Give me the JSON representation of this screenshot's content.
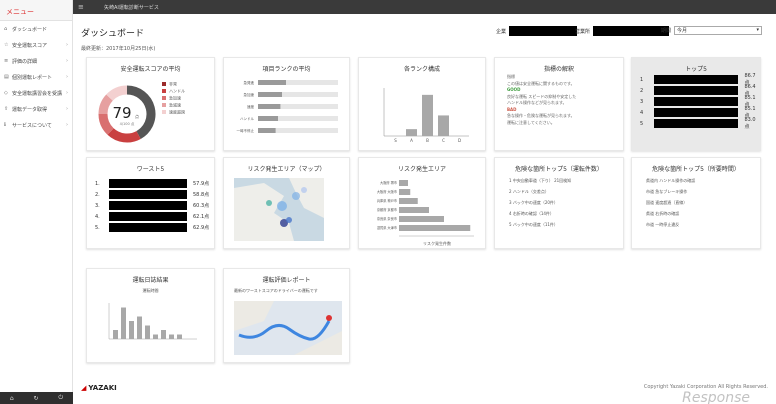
{
  "sidebar": {
    "menu_label": "メニュー",
    "items": [
      {
        "icon": "home-icon",
        "label": "ダッシュボード"
      },
      {
        "icon": "star-icon",
        "label": "安全運転スコア"
      },
      {
        "icon": "list-icon",
        "label": "評価の詳細"
      },
      {
        "icon": "document-icon",
        "label": "個別運転レポート"
      },
      {
        "icon": "shield-icon",
        "label": "安全運転講習会を受講"
      },
      {
        "icon": "upload-icon",
        "label": "運転データ取得"
      },
      {
        "icon": "info-icon",
        "label": "サービスについて"
      }
    ],
    "bottom_icons": [
      "home-icon",
      "refresh-icon",
      "power-icon"
    ]
  },
  "topbar": {
    "title": "矢崎AI運転診断サービス"
  },
  "header": {
    "title": "ダッシュボード",
    "updated": "最終更新：2017年10月25日(水)",
    "filter_company_label": "企業",
    "filter_office_label": "営業所",
    "filter_period_label": "期間",
    "filter_period_value": "今月"
  },
  "cards": {
    "score_avg": {
      "title": "安全運転スコアの平均",
      "score": "79",
      "sub": "4/100 点",
      "legend": [
        "非常",
        "ハンドル",
        "急加速",
        "急減速",
        "速度超過"
      ],
      "legend_colors": [
        "#9b2b2b",
        "#c94040",
        "#d97070",
        "#e6a0a0",
        "#f3d0d0"
      ],
      "segments": [
        0.42,
        0.2,
        0.13,
        0.12,
        0.13
      ]
    },
    "rank_avg": {
      "title": "項目ランクの平均",
      "rows": [
        "急発進",
        "急加速",
        "速度",
        "ハンドル",
        "一時不停止"
      ],
      "values": [
        0.35,
        0.3,
        0.28,
        0.25,
        0.22
      ]
    },
    "rank_dist": {
      "title": "各ランク構成",
      "categories": [
        "S",
        "A",
        "B",
        "C",
        "D"
      ],
      "values": [
        0,
        1,
        6,
        3,
        0
      ]
    },
    "how_to_read": {
      "title": "指標の解釈",
      "lines": [
        "指標",
        "この値は安全運転に関するものです。",
        "GOOD",
        "良好な運転 スピードの抑制や安定した",
        "ハンドル操作などが見られます。",
        "BAD",
        "急な操作・危険な運転が見られます。",
        "運転に注意してください。"
      ]
    },
    "top5": {
      "title": "トップ5",
      "rows": [
        {
          "n": "1",
          "v": "86.7点"
        },
        {
          "n": "2",
          "v": "86.4点"
        },
        {
          "n": "3",
          "v": "85.1点"
        },
        {
          "n": "4",
          "v": "85.1点"
        },
        {
          "n": "5",
          "v": "83.0点"
        }
      ]
    },
    "worst5": {
      "title": "ワースト5",
      "rows": [
        {
          "n": "1.",
          "v": "57.9点"
        },
        {
          "n": "2.",
          "v": "58.8点"
        },
        {
          "n": "3.",
          "v": "60.3点"
        },
        {
          "n": "4.",
          "v": "62.1点"
        },
        {
          "n": "5.",
          "v": "62.9点"
        }
      ]
    },
    "risk_map": {
      "title": "リスク発生エリア（マップ）"
    },
    "risk_area": {
      "title": "リスク発生エリア",
      "xlabel": "リスク発生件数",
      "categories": [
        "大阪府 堺市",
        "大阪府 大阪市",
        "兵庫県 神戸市",
        "京都府 京都市",
        "奈良県 奈良市",
        "滋賀県 大津市"
      ],
      "values": [
        12,
        15,
        25,
        40,
        60,
        95
      ]
    },
    "danger_pts_count": {
      "title": "危険な箇所トップ5（運転件数）",
      "items": [
        "1 中央自動車道（下り） 21回検知",
        "2 ハンドル（交差点）",
        "3 バック中の速度（20件）",
        "4 右折時の確認（14件）",
        "5 バック中の速度（11件）"
      ]
    },
    "danger_pts_time": {
      "title": "危険な箇所トップ5（所要時間）",
      "items": [
        "県道内 ハンドル操作の確認",
        "市道 急なブレーキ操作",
        "国道 速度超過（直線）",
        "県道 右折時の確認",
        "市道 一時停止違反"
      ]
    },
    "trip_analysis": {
      "title": "運転日誌結果",
      "subtitle": "運転時間",
      "values": [
        2,
        7,
        4,
        5,
        3,
        1,
        2,
        1,
        1
      ]
    },
    "risk_report": {
      "title": "運転評価レポート",
      "subtitle": "最新のワーストスコアのドライバーの運転です"
    }
  },
  "footer": {
    "logo": "YAZAKI",
    "copyright": "Copyright Yazaki Corporation All Rights Reserved.",
    "watermark": "Response"
  }
}
